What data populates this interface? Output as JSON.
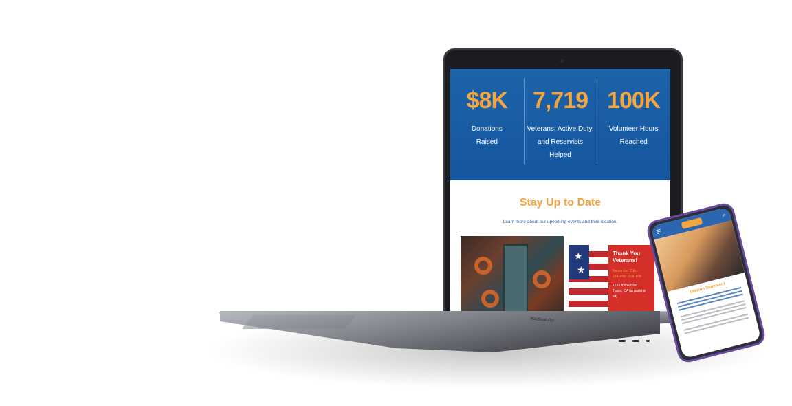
{
  "colors": {
    "accent_orange": "#f5a540",
    "brand_blue": "#1c63a8",
    "event_red": "#d52f2a"
  },
  "stats": [
    {
      "value": "$8K",
      "label_line1": "Donations",
      "label_line2": "Raised"
    },
    {
      "value": "7,719",
      "label_line1": "Veterans, Active Duty,",
      "label_line2": "and Reservists Helped"
    },
    {
      "value": "100K",
      "label_line1": "Volunteer Hours",
      "label_line2": "Reached"
    }
  ],
  "section": {
    "title": "Stay Up to Date",
    "subtitle": "Learn more about our upcoming events and their location."
  },
  "event": {
    "title_line1": "Thank You",
    "title_line2": "Veterans!",
    "date": "November 11th",
    "time": "2:00 PM - 6:00 PM",
    "address_line1": "1232 Irvine Blvd",
    "address_line2": "Tustin, CA (in parking lot)"
  },
  "laptop": {
    "model": "MacBook Pro"
  },
  "phone": {
    "mission_title": "Mission Statement",
    "icons": [
      "menu-icon",
      "search-icon"
    ]
  }
}
